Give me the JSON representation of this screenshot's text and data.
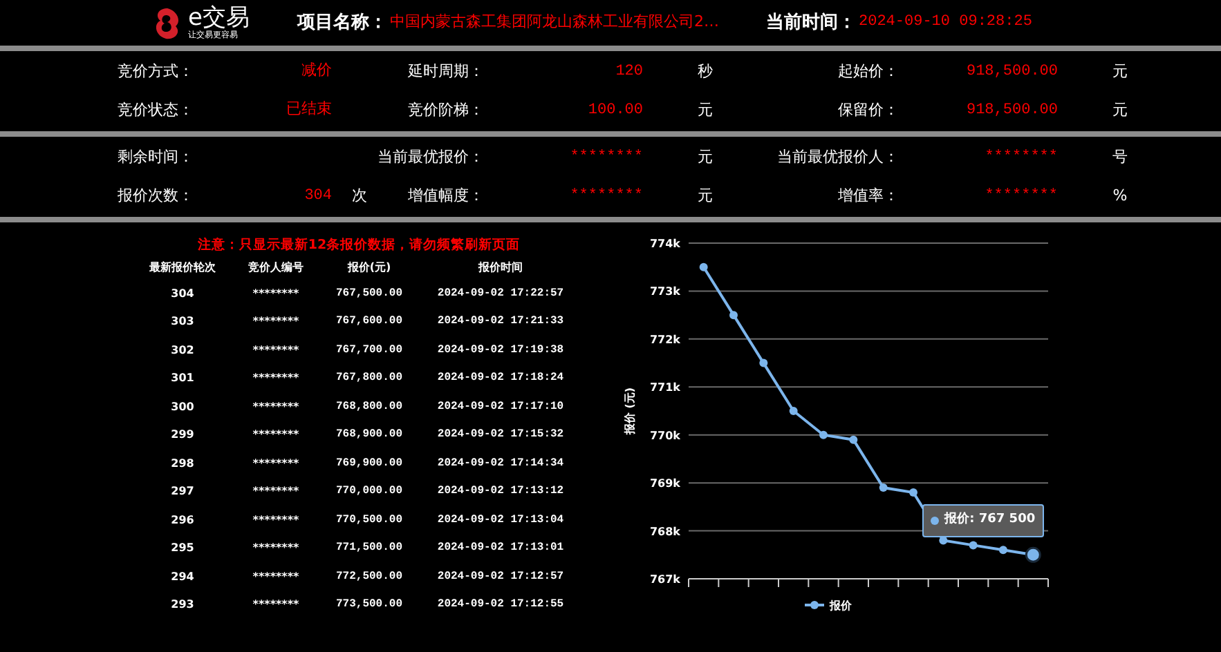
{
  "header": {
    "logo_text": "e交易",
    "logo_slogan": "让交易更容易",
    "project_label": "项目名称：",
    "project_name": "中国内蒙古森工集团阿龙山森林工业有限公司2…",
    "time_label": "当前时间：",
    "time": "2024-09-10 09:28:25"
  },
  "info_sections": [
    [
      [
        {
          "label": "竞价方式：",
          "value": "减价"
        },
        {
          "label": "延时周期：",
          "value": "120",
          "unit": "秒"
        },
        {
          "label": "起始价：",
          "value": "918,500.00",
          "unit": "元"
        }
      ],
      [
        {
          "label": "竞价状态：",
          "value": "已结束"
        },
        {
          "label": "竞价阶梯：",
          "value": "100.00",
          "unit": "元"
        },
        {
          "label": "保留价：",
          "value": "918,500.00",
          "unit": "元"
        }
      ]
    ],
    [
      [
        {
          "label": "剩余时间："
        },
        {
          "label": "当前最优报价：",
          "value": "********",
          "unit": "元"
        },
        {
          "label": "当前最优报价人：",
          "value": "********",
          "unit": "号"
        }
      ],
      [
        {
          "label": "报价次数：",
          "value": "304",
          "unit": "次"
        },
        {
          "label": "增值幅度：",
          "value": "********",
          "unit": "元"
        },
        {
          "label": "增值率：",
          "value": "********",
          "unit": "%"
        }
      ]
    ]
  ],
  "notice": "注意：只显示最新12条报价数据，请勿频繁刷新页面",
  "table": {
    "columns": [
      "最新报价轮次",
      "竞价人编号",
      "报价(元)",
      "报价时间"
    ],
    "rows": [
      [
        "304",
        "********",
        "767,500.00",
        "2024-09-02 17:22:57"
      ],
      [
        "303",
        "********",
        "767,600.00",
        "2024-09-02 17:21:33"
      ],
      [
        "302",
        "********",
        "767,700.00",
        "2024-09-02 17:19:38"
      ],
      [
        "301",
        "********",
        "767,800.00",
        "2024-09-02 17:18:24"
      ],
      [
        "300",
        "********",
        "768,800.00",
        "2024-09-02 17:17:10"
      ],
      [
        "299",
        "********",
        "768,900.00",
        "2024-09-02 17:15:32"
      ],
      [
        "298",
        "********",
        "769,900.00",
        "2024-09-02 17:14:34"
      ],
      [
        "297",
        "********",
        "770,000.00",
        "2024-09-02 17:13:12"
      ],
      [
        "296",
        "********",
        "770,500.00",
        "2024-09-02 17:13:04"
      ],
      [
        "295",
        "********",
        "771,500.00",
        "2024-09-02 17:13:01"
      ],
      [
        "294",
        "********",
        "772,500.00",
        "2024-09-02 17:12:57"
      ],
      [
        "293",
        "********",
        "773,500.00",
        "2024-09-02 17:12:55"
      ]
    ]
  },
  "chart": {
    "tooltip": "报价: 767 500",
    "chart_data": {
      "type": "line",
      "grid": true,
      "ylabel": "报价 (元)",
      "ylim": [
        767000,
        774000
      ],
      "yticks": [
        {
          "value": 767000,
          "label": "767k"
        },
        {
          "value": 768000,
          "label": "768k"
        },
        {
          "value": 769000,
          "label": "769k"
        },
        {
          "value": 770000,
          "label": "770k"
        },
        {
          "value": 771000,
          "label": "771k"
        },
        {
          "value": 772000,
          "label": "772k"
        },
        {
          "value": 773000,
          "label": "773k"
        },
        {
          "value": 774000,
          "label": "774k"
        }
      ],
      "series": [
        {
          "name": "报价",
          "color": "#7cb5ec",
          "marker": true,
          "values": [
            773500,
            772500,
            771500,
            770500,
            770000,
            769900,
            768900,
            768800,
            767800,
            767700,
            767600,
            767500
          ]
        }
      ]
    }
  }
}
